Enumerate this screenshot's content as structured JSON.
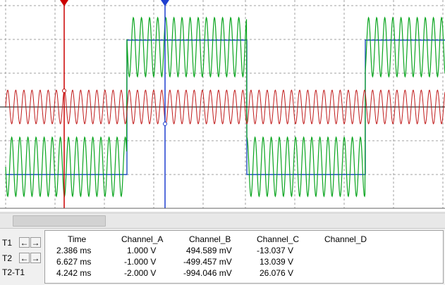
{
  "colors": {
    "grid": "#a0a0a0",
    "digital_trace": "#1f4fbf",
    "green_trace": "#0aa51f",
    "red_trace": "#c01a1a",
    "cursor1": "#cc0000",
    "cursor2": "#1f3fcf"
  },
  "scope": {
    "cursor1_marker_icon": "triangle-down-red",
    "cursor2_marker_icon": "triangle-down-blue"
  },
  "scrollbar": {
    "thumb": "scrollbar-thumb"
  },
  "rows": [
    {
      "label": "T1",
      "left_icon": "←",
      "right_icon": "→"
    },
    {
      "label": "T2",
      "left_icon": "←",
      "right_icon": "→"
    },
    {
      "label": "T2-T1"
    }
  ],
  "table": {
    "headers": [
      "Time",
      "Channel_A",
      "Channel_B",
      "Channel_C",
      "Channel_D"
    ],
    "data": [
      [
        "2.386 ms",
        "1.000 V",
        "494.589 mV",
        "-13.037 V",
        ""
      ],
      [
        "6.627 ms",
        "-1.000 V",
        "-499.457 mV",
        "13.039 V",
        ""
      ],
      [
        "4.242 ms",
        "-2.000 V",
        "-994.046 mV",
        "26.076 V",
        ""
      ]
    ]
  }
}
